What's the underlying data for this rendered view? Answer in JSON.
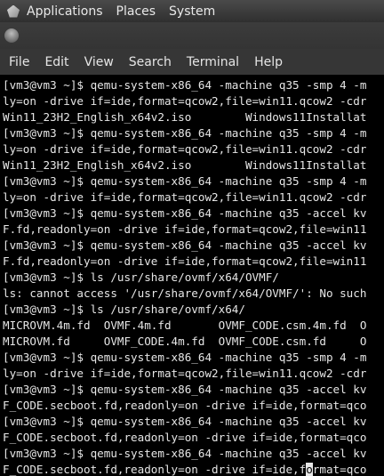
{
  "top_panel": {
    "items": [
      "Applications",
      "Places",
      "System"
    ]
  },
  "menubar": {
    "items": [
      "File",
      "Edit",
      "View",
      "Search",
      "Terminal",
      "Help"
    ]
  },
  "terminal": {
    "lines": [
      "[vm3@vm3 ~]$ qemu-system-x86_64 -machine q35 -smp 4 -m",
      "ly=on -drive if=ide,format=qcow2,file=win11.qcow2 -cdr",
      "Win11_23H2_English_x64v2.iso        Windows11Installat",
      "[vm3@vm3 ~]$ qemu-system-x86_64 -machine q35 -smp 4 -m",
      "ly=on -drive if=ide,format=qcow2,file=win11.qcow2 -cdr",
      "Win11_23H2_English_x64v2.iso        Windows11Installat",
      "[vm3@vm3 ~]$ qemu-system-x86_64 -machine q35 -smp 4 -m",
      "ly=on -drive if=ide,format=qcow2,file=win11.qcow2 -cdr",
      "[vm3@vm3 ~]$ qemu-system-x86_64 -machine q35 -accel kv",
      "F.fd,readonly=on -drive if=ide,format=qcow2,file=win11",
      "[vm3@vm3 ~]$ qemu-system-x86_64 -machine q35 -accel kv",
      "F.fd,readonly=on -drive if=ide,format=qcow2,file=win11",
      "[vm3@vm3 ~]$ ls /usr/share/ovmf/x64/OVMF/",
      "ls: cannot access '/usr/share/ovmf/x64/OVMF/': No such",
      "[vm3@vm3 ~]$ ls /usr/share/ovmf/x64/",
      "MICROVM.4m.fd  OVMF.4m.fd       OVMF_CODE.csm.4m.fd  O",
      "MICROVM.fd     OVMF_CODE.4m.fd  OVMF_CODE.csm.fd     O",
      "[vm3@vm3 ~]$ qemu-system-x86_64 -machine q35 -smp 4 -m",
      "ly=on -drive if=ide,format=qcow2,file=win11.qcow2 -cdr",
      "[vm3@vm3 ~]$ qemu-system-x86_64 -machine q35 -accel kv",
      "F_CODE.secboot.fd,readonly=on -drive if=ide,format=qco",
      "[vm3@vm3 ~]$ qemu-system-x86_64 -machine q35 -accel kv",
      "F_CODE.secboot.fd,readonly=on -drive if=ide,format=qco",
      "[vm3@vm3 ~]$ qemu-system-x86_64 -machine q35 -accel kv",
      "F_CODE.secboot.fd,readonly=on -drive if=ide,format=qco"
    ],
    "cursor_line": 24,
    "cursor_col": 45
  }
}
